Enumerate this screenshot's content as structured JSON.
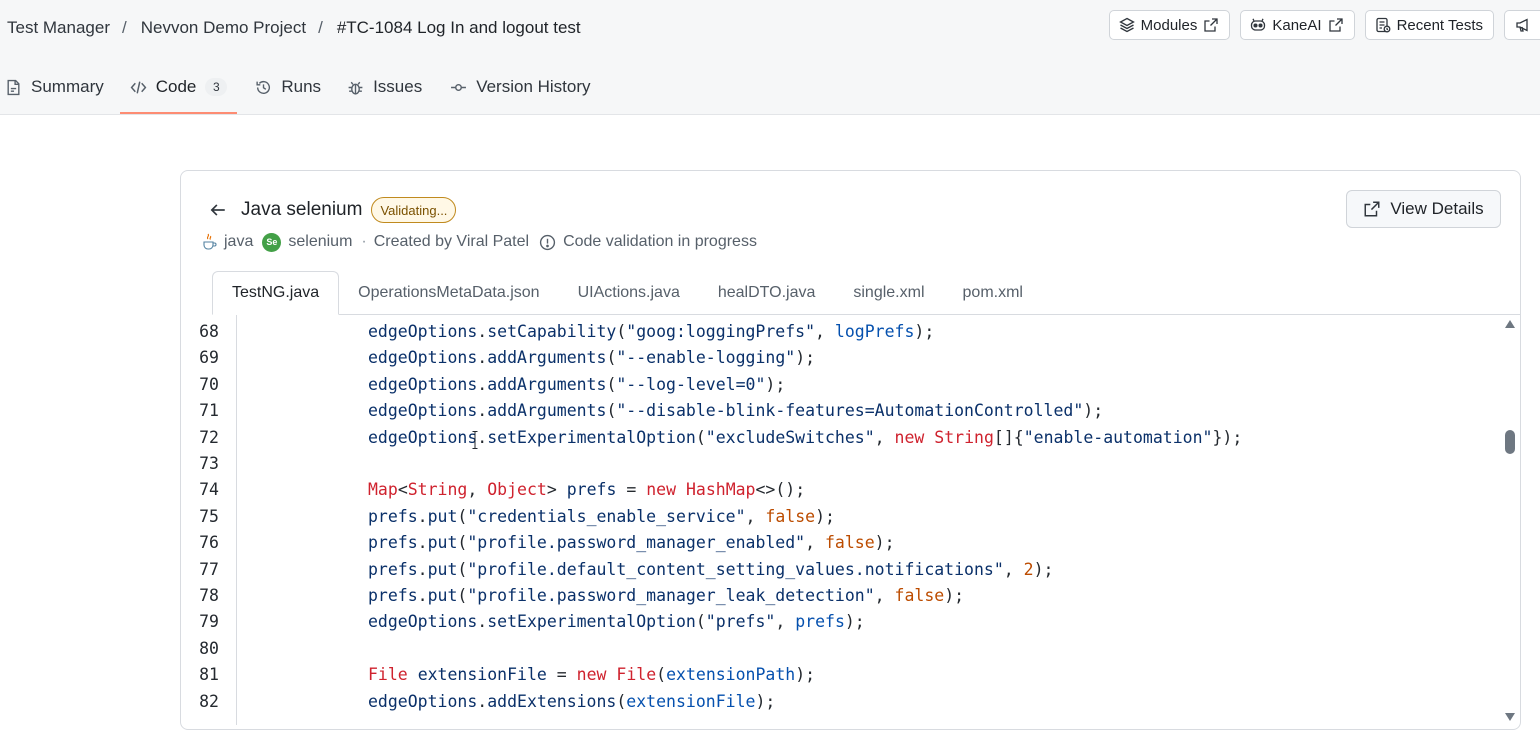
{
  "breadcrumb": {
    "items": [
      "Test Manager",
      "Nevvon Demo Project",
      "#TC-1084 Log In and logout test"
    ],
    "separator": "/"
  },
  "top_actions": {
    "modules": "Modules",
    "kaneai": "KaneAI",
    "recent_tests": "Recent Tests"
  },
  "tabs": [
    {
      "label": "Summary",
      "icon": "document-icon"
    },
    {
      "label": "Code",
      "icon": "code-icon",
      "count": "3",
      "active": true
    },
    {
      "label": "Runs",
      "icon": "history-icon"
    },
    {
      "label": "Issues",
      "icon": "bug-icon"
    },
    {
      "label": "Version History",
      "icon": "commit-icon"
    }
  ],
  "card": {
    "title": "Java selenium",
    "status_badge": "Validating...",
    "language": "java",
    "framework": "selenium",
    "meta_separator": "·",
    "created_by": "Created by Viral Patel",
    "validation_status": "Code validation in progress",
    "view_details": "View Details"
  },
  "file_tabs": [
    "TestNG.java",
    "OperationsMetaData.json",
    "UIActions.java",
    "healDTO.java",
    "single.xml",
    "pom.xml"
  ],
  "active_file": "TestNG.java",
  "code_lines": [
    {
      "n": "68",
      "t": [
        [
          "id",
          "edgeOptions"
        ],
        [
          "pun",
          "."
        ],
        [
          "id",
          "setCapability"
        ],
        [
          "pun",
          "("
        ],
        [
          "str",
          "\"goog:loggingPrefs\""
        ],
        [
          "pun",
          ", "
        ],
        [
          "var",
          "logPrefs"
        ],
        [
          "pun",
          ");"
        ]
      ]
    },
    {
      "n": "69",
      "t": [
        [
          "id",
          "edgeOptions"
        ],
        [
          "pun",
          "."
        ],
        [
          "id",
          "addArguments"
        ],
        [
          "pun",
          "("
        ],
        [
          "str",
          "\"--enable-logging\""
        ],
        [
          "pun",
          ");"
        ]
      ]
    },
    {
      "n": "70",
      "t": [
        [
          "id",
          "edgeOptions"
        ],
        [
          "pun",
          "."
        ],
        [
          "id",
          "addArguments"
        ],
        [
          "pun",
          "("
        ],
        [
          "str",
          "\"--log-level=0\""
        ],
        [
          "pun",
          ");"
        ]
      ]
    },
    {
      "n": "71",
      "t": [
        [
          "id",
          "edgeOptions"
        ],
        [
          "pun",
          "."
        ],
        [
          "id",
          "addArguments"
        ],
        [
          "pun",
          "("
        ],
        [
          "str",
          "\"--disable-blink-features=AutomationControlled\""
        ],
        [
          "pun",
          ");"
        ]
      ]
    },
    {
      "n": "72",
      "t": [
        [
          "id",
          "edgeOptions"
        ],
        [
          "pun",
          "."
        ],
        [
          "id",
          "setExperimentalOption"
        ],
        [
          "pun",
          "("
        ],
        [
          "str",
          "\"excludeSwitches\""
        ],
        [
          "pun",
          ", "
        ],
        [
          "kw",
          "new"
        ],
        [
          "pun",
          " "
        ],
        [
          "type",
          "String"
        ],
        [
          "pun",
          "[]{"
        ],
        [
          "str",
          "\"enable-automation\""
        ],
        [
          "pun",
          "});"
        ]
      ]
    },
    {
      "n": "73",
      "t": []
    },
    {
      "n": "74",
      "t": [
        [
          "type",
          "Map"
        ],
        [
          "pun",
          "<"
        ],
        [
          "type",
          "String"
        ],
        [
          "pun",
          ", "
        ],
        [
          "type",
          "Object"
        ],
        [
          "pun",
          "> "
        ],
        [
          "id",
          "prefs"
        ],
        [
          "pun",
          " = "
        ],
        [
          "kw",
          "new"
        ],
        [
          "pun",
          " "
        ],
        [
          "type",
          "HashMap"
        ],
        [
          "pun",
          "<>();"
        ]
      ]
    },
    {
      "n": "75",
      "t": [
        [
          "id",
          "prefs"
        ],
        [
          "pun",
          "."
        ],
        [
          "id",
          "put"
        ],
        [
          "pun",
          "("
        ],
        [
          "str",
          "\"credentials_enable_service\""
        ],
        [
          "pun",
          ", "
        ],
        [
          "lit",
          "false"
        ],
        [
          "pun",
          ");"
        ]
      ]
    },
    {
      "n": "76",
      "t": [
        [
          "id",
          "prefs"
        ],
        [
          "pun",
          "."
        ],
        [
          "id",
          "put"
        ],
        [
          "pun",
          "("
        ],
        [
          "str",
          "\"profile.password_manager_enabled\""
        ],
        [
          "pun",
          ", "
        ],
        [
          "lit",
          "false"
        ],
        [
          "pun",
          ");"
        ]
      ]
    },
    {
      "n": "77",
      "t": [
        [
          "id",
          "prefs"
        ],
        [
          "pun",
          "."
        ],
        [
          "id",
          "put"
        ],
        [
          "pun",
          "("
        ],
        [
          "str",
          "\"profile.default_content_setting_values.notifications\""
        ],
        [
          "pun",
          ", "
        ],
        [
          "lit",
          "2"
        ],
        [
          "pun",
          ");"
        ]
      ]
    },
    {
      "n": "78",
      "t": [
        [
          "id",
          "prefs"
        ],
        [
          "pun",
          "."
        ],
        [
          "id",
          "put"
        ],
        [
          "pun",
          "("
        ],
        [
          "str",
          "\"profile.password_manager_leak_detection\""
        ],
        [
          "pun",
          ", "
        ],
        [
          "lit",
          "false"
        ],
        [
          "pun",
          ");"
        ]
      ]
    },
    {
      "n": "79",
      "t": [
        [
          "id",
          "edgeOptions"
        ],
        [
          "pun",
          "."
        ],
        [
          "id",
          "setExperimentalOption"
        ],
        [
          "pun",
          "("
        ],
        [
          "str",
          "\"prefs\""
        ],
        [
          "pun",
          ", "
        ],
        [
          "var",
          "prefs"
        ],
        [
          "pun",
          ");"
        ]
      ]
    },
    {
      "n": "80",
      "t": []
    },
    {
      "n": "81",
      "t": [
        [
          "type",
          "File"
        ],
        [
          "pun",
          " "
        ],
        [
          "id",
          "extensionFile"
        ],
        [
          "pun",
          " = "
        ],
        [
          "kw",
          "new"
        ],
        [
          "pun",
          " "
        ],
        [
          "type",
          "File"
        ],
        [
          "pun",
          "("
        ],
        [
          "var",
          "extensionPath"
        ],
        [
          "pun",
          ");"
        ]
      ]
    },
    {
      "n": "82",
      "t": [
        [
          "id",
          "edgeOptions"
        ],
        [
          "pun",
          "."
        ],
        [
          "id",
          "addExtensions"
        ],
        [
          "pun",
          "("
        ],
        [
          "var",
          "extensionFile"
        ],
        [
          "pun",
          ");"
        ]
      ]
    }
  ]
}
